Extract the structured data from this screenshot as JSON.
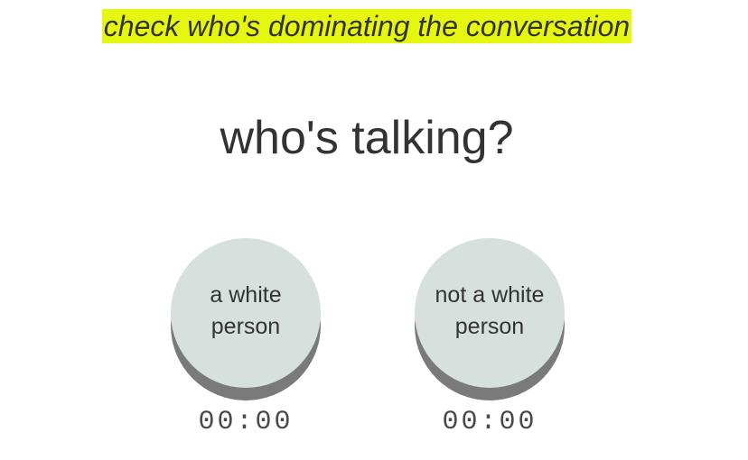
{
  "header": {
    "tagline": "check who's dominating the conversation"
  },
  "main": {
    "question": "who's talking?"
  },
  "speakers": [
    {
      "label": "a white person",
      "timer": "00:00"
    },
    {
      "label": "not a white person",
      "timer": "00:00"
    }
  ],
  "colors": {
    "highlight": "#e5f70e",
    "button_face": "#d6e0dc",
    "button_shadow": "#7a7a7a",
    "text": "#333333"
  }
}
